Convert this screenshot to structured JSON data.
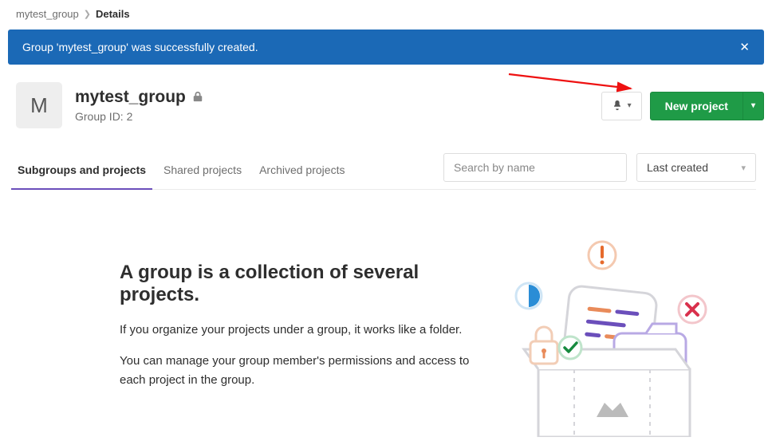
{
  "breadcrumbs": {
    "group": "mytest_group",
    "current": "Details"
  },
  "alert": {
    "message": "Group 'mytest_group' was successfully created."
  },
  "group": {
    "avatar_letter": "M",
    "name": "mytest_group",
    "id_label": "Group ID: 2"
  },
  "actions": {
    "new_project": "New project"
  },
  "tabs": {
    "subgroups": "Subgroups and projects",
    "shared": "Shared projects",
    "archived": "Archived projects"
  },
  "filters": {
    "search_placeholder": "Search by name",
    "sort_label": "Last created"
  },
  "empty": {
    "title": "A group is a collection of several projects.",
    "p1": "If you organize your projects under a group, it works like a folder.",
    "p2": "You can manage your group member's permissions and access to each project in the group."
  }
}
